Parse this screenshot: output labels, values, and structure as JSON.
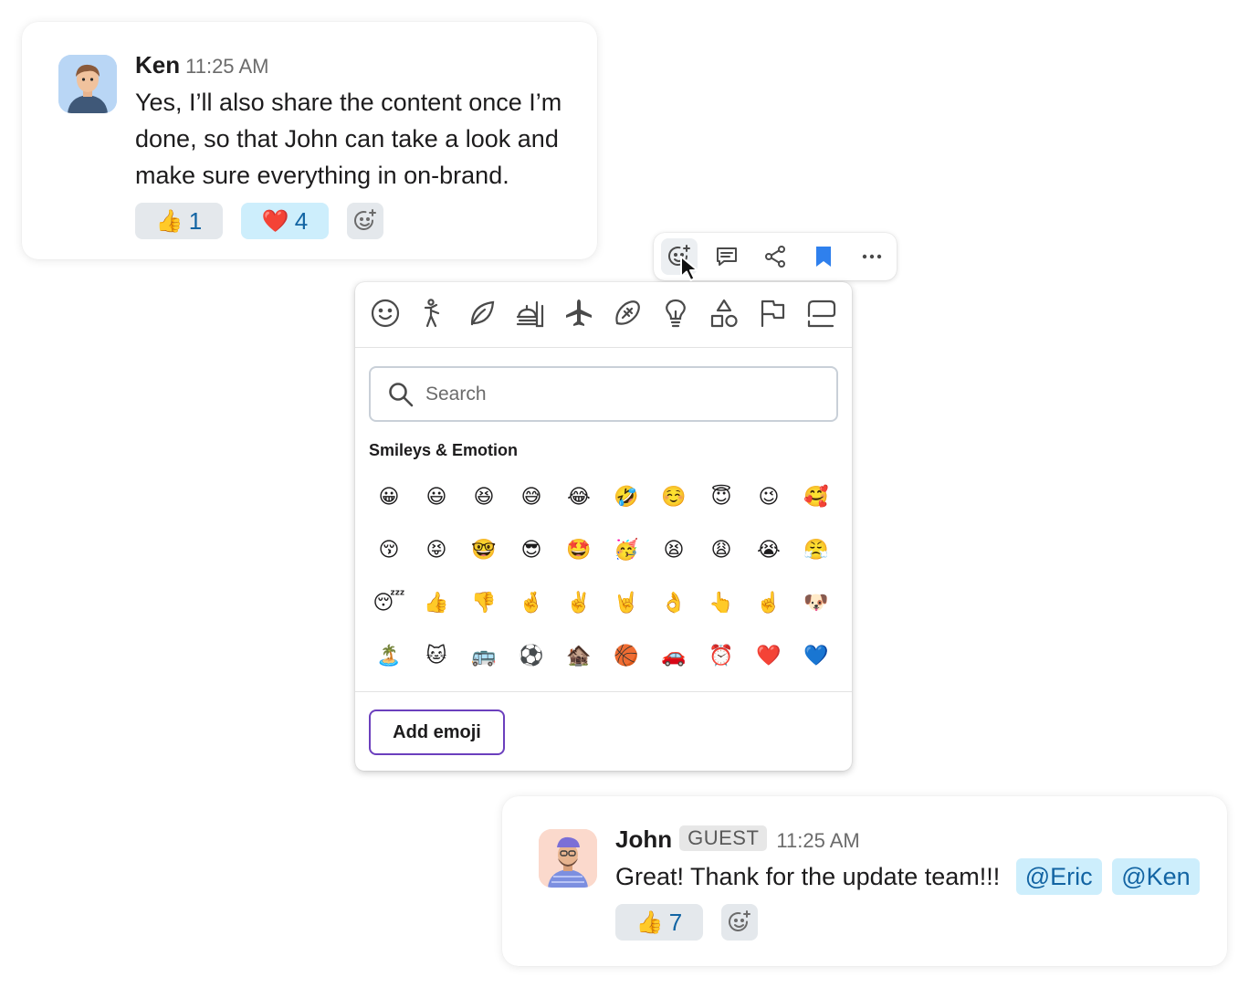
{
  "message1": {
    "author": "Ken",
    "time": "11:25 AM",
    "lines": [
      "Yes, I’ll also share the content once I’m",
      "done, so that John can take a look and",
      "make sure everything in on-brand."
    ],
    "reactions": [
      {
        "emoji": "👍",
        "count": "1",
        "active": false
      },
      {
        "emoji": "❤️",
        "count": "4",
        "active": true
      }
    ]
  },
  "toolbar": {
    "icons": [
      "add-reaction-icon",
      "reply-thread-icon",
      "share-icon",
      "bookmark-icon",
      "more-icon"
    ],
    "bookmark_color": "#2f80ed"
  },
  "picker": {
    "categories": [
      "smileys-icon",
      "people-icon",
      "nature-icon",
      "food-icon",
      "travel-icon",
      "activity-icon",
      "objects-icon",
      "symbols-icon",
      "flags-icon",
      "custom-icon"
    ],
    "search_placeholder": "Search",
    "section_title": "Smileys & Emotion",
    "emoji_rows": [
      [
        "😀",
        "😃",
        "😆",
        "😅",
        "😂",
        "🤣",
        "☺️",
        "😇",
        "😉",
        "🥰"
      ],
      [
        "😚",
        "😝",
        "🤓",
        "😎",
        "🤩",
        "🥳",
        "😫",
        "😩",
        "😭",
        "😤"
      ],
      [
        "😴",
        "👍",
        "👎",
        "🤞",
        "✌️",
        "🤘",
        "👌",
        "👆",
        "☝️",
        "🐶"
      ],
      [
        "🏝️",
        "🐱",
        "🚌",
        "⚽",
        "🏚️",
        "🏀",
        "🚗",
        "⏰",
        "❤️",
        "💙"
      ]
    ],
    "add_emoji_label": "Add emoji",
    "accent_color": "#6b3fbd"
  },
  "message2": {
    "author": "John",
    "badge": "GUEST",
    "time": "11:25 AM",
    "text": "Great! Thank for the update team!!!",
    "mentions": [
      "@Eric",
      "@Ken"
    ],
    "reactions": [
      {
        "emoji": "👍",
        "count": "7",
        "active": false
      }
    ]
  }
}
